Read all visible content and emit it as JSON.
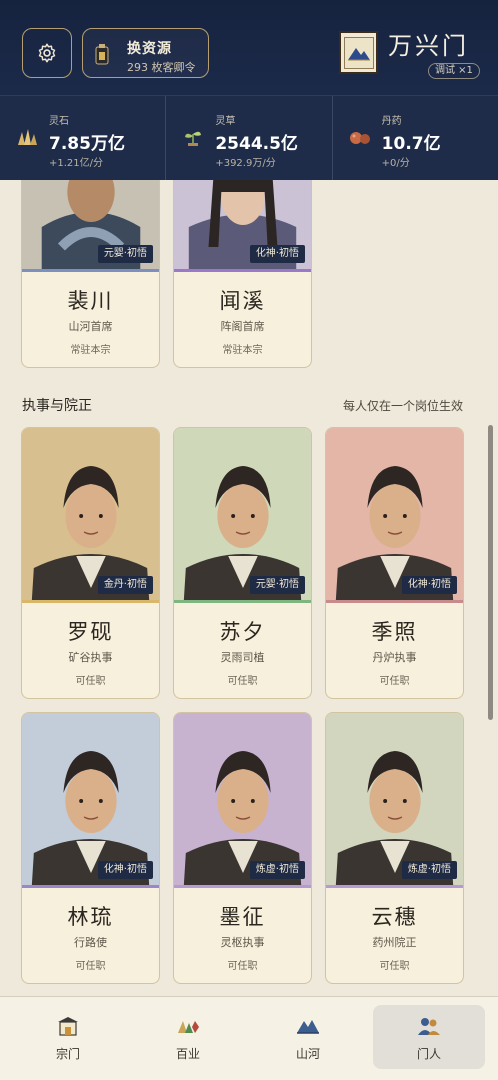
{
  "header": {
    "source_button": {
      "title": "换资源",
      "subtitle": "293 枚客卿令"
    },
    "sect": {
      "name": "万兴门",
      "badge": "调试 ×1"
    }
  },
  "resources": [
    {
      "label": "灵石",
      "value": "7.85万亿",
      "rate": "+1.21亿/分",
      "icon": "spirit-stone-icon"
    },
    {
      "label": "灵草",
      "value": "2544.5亿",
      "rate": "+392.9万/分",
      "icon": "herb-icon"
    },
    {
      "label": "丹药",
      "value": "10.7亿",
      "rate": "+0/分",
      "icon": "pill-icon"
    }
  ],
  "top_cards": [
    {
      "name": "裴川",
      "role": "山河首席",
      "status": "常驻本宗",
      "realm": "元婴·初悟",
      "accent": "#7d8fbf"
    },
    {
      "name": "闻溪",
      "role": "阵阁首席",
      "status": "常驻本宗",
      "realm": "化神·初悟",
      "accent": "#9a7ac8"
    }
  ],
  "section": {
    "title": "执事与院正",
    "note": "每人仅在一个岗位生效"
  },
  "cards": [
    {
      "name": "罗砚",
      "role": "矿谷执事",
      "status": "可任职",
      "realm": "金丹·初悟",
      "accent": "#d8b768",
      "bg": "#d8bf8f"
    },
    {
      "name": "苏夕",
      "role": "灵雨司植",
      "status": "可任职",
      "realm": "元婴·初悟",
      "accent": "#7fb57f",
      "bg": "#cfd8b8"
    },
    {
      "name": "季照",
      "role": "丹炉执事",
      "status": "可任职",
      "realm": "化神·初悟",
      "accent": "#c78b8b",
      "bg": "#e3b6a8"
    },
    {
      "name": "林琉",
      "role": "行路使",
      "status": "可任职",
      "realm": "化神·初悟",
      "accent": "#9b86c9",
      "bg": "#c3ccd9"
    },
    {
      "name": "墨征",
      "role": "灵枢执事",
      "status": "可任职",
      "realm": "炼虚·初悟",
      "accent": "#b79ad2",
      "bg": "#c7b3d0"
    },
    {
      "name": "云穗",
      "role": "药州院正",
      "status": "可任职",
      "realm": "炼虚·初悟",
      "accent": "#b79ad2",
      "bg": "#d2d6be"
    }
  ],
  "nav": [
    {
      "label": "宗门",
      "icon": "sect-hall-icon",
      "active": false
    },
    {
      "label": "百业",
      "icon": "crafts-icon",
      "active": false
    },
    {
      "label": "山河",
      "icon": "mountains-icon",
      "active": false
    },
    {
      "label": "门人",
      "icon": "disciples-icon",
      "active": true
    }
  ]
}
